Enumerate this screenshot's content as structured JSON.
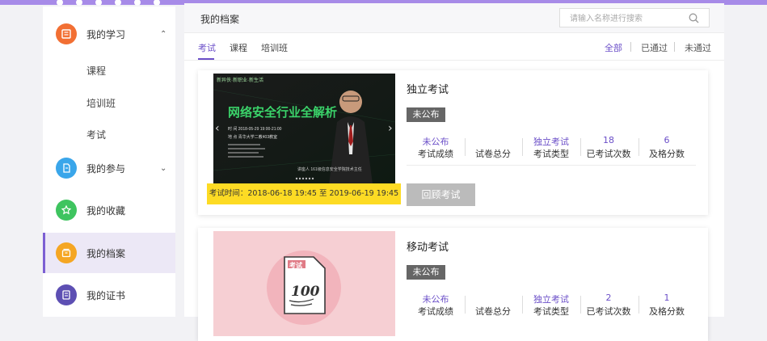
{
  "sidebar": {
    "items": [
      {
        "label": "我的学习",
        "icon": "book-icon",
        "color": "#f26f33",
        "expanded": true,
        "children": [
          "课程",
          "培训班",
          "考试"
        ]
      },
      {
        "label": "我的参与",
        "icon": "document-icon",
        "color": "#3aa6ea"
      },
      {
        "label": "我的收藏",
        "icon": "star-icon",
        "color": "#3ec45f"
      },
      {
        "label": "我的档案",
        "icon": "archive-icon",
        "color": "#f5a623",
        "active": true
      },
      {
        "label": "我的证书",
        "icon": "certificate-icon",
        "color": "#5d4fb3"
      }
    ]
  },
  "header": {
    "title": "我的档案",
    "search_placeholder": "请输入名称进行搜索"
  },
  "tabs": [
    "考试",
    "课程",
    "培训班"
  ],
  "filters": [
    "全部",
    "已通过",
    "未通过"
  ],
  "colors": {
    "accent": "#6b4fc8",
    "highlight": "#fddb24",
    "topbar": "#a78be8"
  },
  "cards": [
    {
      "title": "独立考试",
      "status": "未公布",
      "thumbnail": {
        "top": "新异侠·新职业·新生活",
        "headline": "网络安全行业全解析",
        "line1": "时 间 2018-05-29 19:00-21:00",
        "line2": "地 点 青华大学二教403教室",
        "footer": "讲座人 161级信息安全学院技术主任"
      },
      "stats": [
        {
          "value": "未公布",
          "label": "考试成绩"
        },
        {
          "value": "",
          "label": "试卷总分"
        },
        {
          "value": "独立考试",
          "label": "考试类型"
        },
        {
          "value": "18",
          "label": "已考试次数"
        },
        {
          "value": "6",
          "label": "及格分数"
        }
      ],
      "time": "考试时间：2018-06-18 19:45 至 2019-06-19 19:45",
      "action": "回顾考试"
    },
    {
      "title": "移动考试",
      "status": "未公布",
      "thumbnail": {
        "paper_label": "考试",
        "paper_score": "100"
      },
      "stats": [
        {
          "value": "未公布",
          "label": "考试成绩"
        },
        {
          "value": "",
          "label": "试卷总分"
        },
        {
          "value": "独立考试",
          "label": "考试类型"
        },
        {
          "value": "2",
          "label": "已考试次数"
        },
        {
          "value": "1",
          "label": "及格分数"
        }
      ]
    }
  ]
}
